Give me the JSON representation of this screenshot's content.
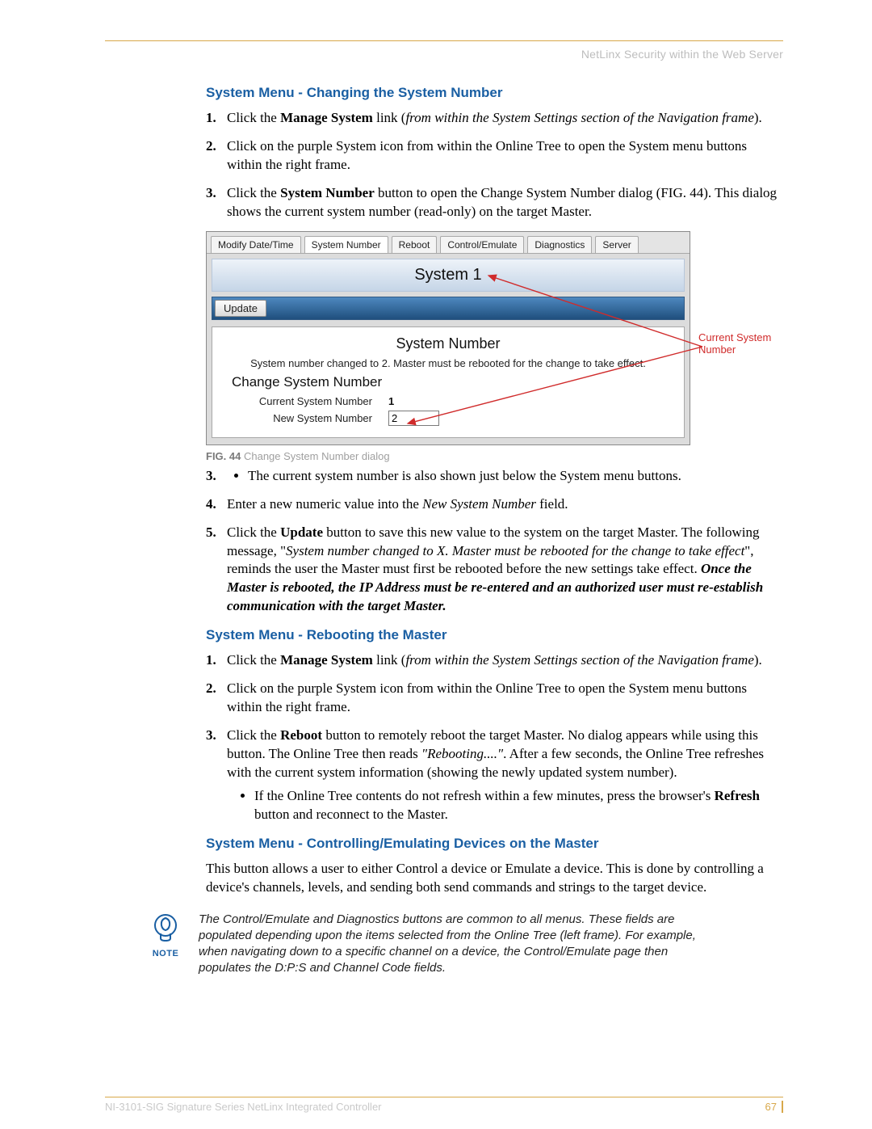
{
  "header": {
    "title": "NetLinx Security within the Web Server"
  },
  "section1": {
    "title": "System Menu - Changing the System Number",
    "step1_a": "Click the ",
    "step1_b": "Manage System",
    "step1_c": " link (",
    "step1_d": "from within the System Settings section of the Navigation frame",
    "step1_e": ").",
    "step2": "Click on the purple System icon from within the Online Tree to open the System menu buttons within the right frame.",
    "step3_a": "Click the ",
    "step3_b": "System Number",
    "step3_c": " button to open the Change System Number dialog (FIG. 44). This dialog shows the current system number (read-only) on the target Master.",
    "bullet1": "The current system number is also shown just below the System menu buttons.",
    "step4_a": "Enter a new numeric value into the ",
    "step4_b": "New System Number",
    "step4_c": " field.",
    "step5_a": "Click the ",
    "step5_b": "Update",
    "step5_c": " button to save this new value to the system on the target Master. The following message, \"",
    "step5_d": "System number changed to X. Master must be rebooted for the change to take effect",
    "step5_e": "\", reminds the user the Master must first be rebooted before the new settings take effect. ",
    "step5_f": "Once the Master is rebooted, the IP Address must be re-entered and an authorized user must re-establish communication with the target Master."
  },
  "dialog": {
    "tabs": [
      "Modify Date/Time",
      "System Number",
      "Reboot",
      "Control/Emulate",
      "Diagnostics",
      "Server"
    ],
    "system_title": "System 1",
    "update_label": "Update",
    "panel_title": "System Number",
    "panel_msg": "System number changed to 2. Master must be rebooted for the change to take effect.",
    "panel_sub": "Change System Number",
    "row1_label": "Current System Number",
    "row1_value": "1",
    "row2_label": "New System Number",
    "row2_value": "2",
    "callout": "Current System Number",
    "caption_b": "FIG. 44",
    "caption_r": "  Change System Number dialog"
  },
  "section2": {
    "title": "System Menu - Rebooting the Master",
    "step1_a": "Click the ",
    "step1_b": "Manage System",
    "step1_c": " link (",
    "step1_d": "from within the System Settings section of the Navigation frame",
    "step1_e": ").",
    "step2": "Click on the purple System icon from within the Online Tree to open the System menu buttons within the right frame.",
    "step3_a": "Click the ",
    "step3_b": "Reboot",
    "step3_c": " button to remotely reboot the target Master. No dialog appears while using this button. The Online Tree then reads ",
    "step3_d": "\"Rebooting....\"",
    "step3_e": ". After a few seconds, the Online Tree refreshes with the current system information (showing the newly updated system number).",
    "bullet_a": "If the Online Tree contents do not refresh within a few minutes, press the browser's ",
    "bullet_b": "Refresh",
    "bullet_c": " button and reconnect to the Master."
  },
  "section3": {
    "title": "System Menu - Controlling/Emulating Devices on the Master",
    "para": "This button allows a user to either Control a device or Emulate a device. This is done by controlling a device's channels, levels, and sending both send commands and strings to the target device."
  },
  "note": {
    "label": "NOTE",
    "text": "The Control/Emulate and Diagnostics buttons are common to all menus. These fields are populated depending upon the items selected from the Online Tree (left frame). For example, when navigating down to a specific channel on a device, the Control/Emulate page then populates the D:P:S and Channel Code fields."
  },
  "footer": {
    "product": "NI-3101-SIG Signature Series NetLinx Integrated Controller",
    "page": "67"
  }
}
